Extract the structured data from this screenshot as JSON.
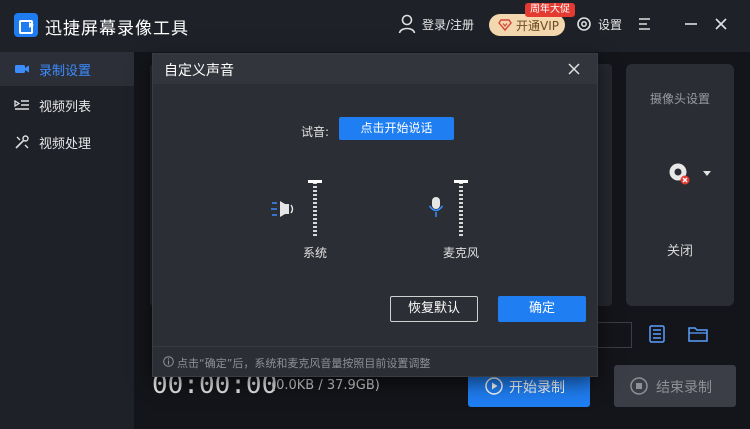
{
  "app": {
    "title": "迅捷屏幕录像工具",
    "login": "登录/注册",
    "vip": "开通VIP",
    "promo": "周年大促",
    "settings": "设置"
  },
  "sidebar": {
    "items": [
      {
        "label": "录制设置",
        "active": true
      },
      {
        "label": "视频列表",
        "active": false
      },
      {
        "label": "视频处理",
        "active": false
      }
    ]
  },
  "camera": {
    "title": "摄像头设置",
    "state": "关闭"
  },
  "bottom": {
    "timer": "00:00:00",
    "storage": "(0.0KB / 37.9GB)",
    "start": "开始录制",
    "stop": "结束录制"
  },
  "dialog": {
    "title": "自定义声音",
    "test_label": "试音:",
    "test_button": "点击开始说话",
    "system_label": "系统",
    "mic_label": "麦克风",
    "system_volume": 1.0,
    "mic_volume": 1.0,
    "restore": "恢复默认",
    "ok": "确定",
    "note": "点击“确定”后，系统和麦克风音量按照目前设置调整"
  },
  "colors": {
    "accent": "#1f7ef2",
    "background": "#1f2129",
    "dialog": "#2c2e35",
    "vip": "#f3d7ae",
    "promo": "#e33a32"
  }
}
